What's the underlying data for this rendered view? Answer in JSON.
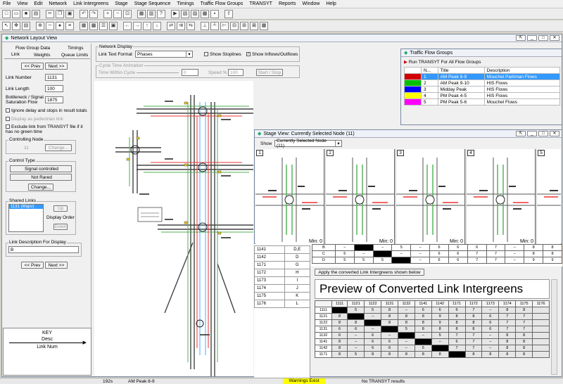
{
  "menu": [
    "File",
    "View",
    "Edit",
    "Network",
    "Link Intergreens",
    "Stage",
    "Stage Sequence",
    "Timings",
    "Traffic Flow Groups",
    "TRANSYT",
    "Reports",
    "Window",
    "Help"
  ],
  "network_window": {
    "title": "Network Layout View"
  },
  "link_panel": {
    "tabs_row1": [
      "Flow Group Data",
      "Timings"
    ],
    "tabs_row2": [
      "Link",
      "Weights",
      "Queue Limits"
    ],
    "prev_label": "<< Prev",
    "next_label": "Next >>",
    "link_number_label": "Link Number",
    "link_number": "1131",
    "link_length_label": "Link Length",
    "link_length": "100",
    "sat_flow_label": "Bottleneck / Signal Saturation Flow",
    "sat_flow": "1875",
    "ignore_delay": "Ignore delay and stops in result totals",
    "display_ped": "Display as pedestrian link",
    "exclude_link": "Exclude link from TRANSYT file if it has no green time",
    "controlling_node_label": "Controlling Node",
    "controlling_node": "11",
    "change_label": "Change...",
    "control_type_label": "Control Type",
    "control_type": "Signal controlled",
    "rared": "Not Rared",
    "shared_links_label": "Shared Links",
    "shared_link_item": "1131 (Major)",
    "up_label": "Up",
    "display_order": "Display Order",
    "down_label": "Down",
    "link_desc_label": "Link Description For Display",
    "link_desc": "B"
  },
  "key": {
    "title": "KEY",
    "desc": "Desc",
    "num": "Link Num"
  },
  "network_display": {
    "label": "Network Display",
    "format_label": "Link Text Format",
    "format_value": "Phases",
    "stoplines": "Show Stoplines",
    "inflows": "Show Inflows/Outflows",
    "anim_label": "Cycle Time Animation",
    "time_label": "Time Within Cycle",
    "time_value": "0",
    "speed_label": "Speed %",
    "speed_value": "100",
    "start_label": "Start / Stop"
  },
  "flow_groups": {
    "title": "Traffic Flow Groups",
    "run_label": "Run TRANSYT For All Flow Groups",
    "columns": [
      "N...",
      "Title",
      "Description"
    ],
    "rows": [
      {
        "n": "1",
        "title": "AM Peak 8-9",
        "desc": "Mouchel Parkman Flows",
        "color": "#d00000"
      },
      {
        "n": "2",
        "title": "AM Peak 9-10",
        "desc": "HIS Flows",
        "color": "#00c000"
      },
      {
        "n": "3",
        "title": "Midday Peak",
        "desc": "HIS Flows",
        "color": "#0000ff"
      },
      {
        "n": "4",
        "title": "PM Peak 4-5",
        "desc": "HIS Flows",
        "color": "#ffff00"
      },
      {
        "n": "5",
        "title": "PM Peak 5-6",
        "desc": "Mouchel Flows",
        "color": "#ff00ff"
      }
    ]
  },
  "stage_view": {
    "title": "Stage View: Currently Selected Node (11)",
    "show_label": "Show",
    "show_value": "Currently Selected Node (11)",
    "stages": [
      "1",
      "2",
      "3",
      "4",
      "5"
    ],
    "min_label": "Min: 0"
  },
  "link_list": [
    "1141",
    "1142",
    "1171",
    "1172",
    "1173",
    "1174",
    "1175",
    "1176"
  ],
  "link_list_codes": [
    "D,E",
    "D",
    "G",
    "H",
    "I",
    "J",
    "K",
    "L"
  ],
  "ig_top_rows": [
    [
      "B",
      "–",
      "",
      "–",
      "5",
      "–",
      "6",
      "6",
      "6",
      "7",
      "–",
      "8",
      "8"
    ],
    [
      "C",
      "5",
      "–",
      "",
      "–",
      "–",
      "6",
      "6",
      "7",
      "7",
      "–",
      "8",
      "8"
    ],
    [
      "D",
      "5",
      "5",
      "5",
      "",
      "–",
      "6",
      "6",
      "7",
      "7",
      "–",
      "9",
      "9"
    ]
  ],
  "preview": {
    "apply_label": "Apply the converted Link Intergreens shown below",
    "title": "Preview of Converted Link Intergreens",
    "cols": [
      "",
      "1111",
      "1121",
      "1122",
      "1131",
      "1132",
      "1141",
      "1142",
      "1171",
      "1172",
      "1173",
      "1174",
      "1175",
      "1176"
    ],
    "rows": [
      [
        "1111",
        "",
        "5",
        "5",
        "8",
        "–",
        "6",
        "6",
        "6",
        "7",
        "–",
        "8",
        "8",
        ""
      ],
      [
        "1121",
        "8",
        "",
        "–",
        "8",
        "8",
        "8",
        "9",
        "8",
        "8",
        "6",
        "7",
        "7",
        ""
      ],
      [
        "1122",
        "8",
        "8",
        "–",
        "8",
        "8",
        "8",
        "9",
        "8",
        "8",
        "6",
        "7",
        "7",
        ""
      ],
      [
        "1131",
        "6",
        "6",
        "–",
        "",
        "5",
        "8",
        "8",
        "8",
        "8",
        "6",
        "7",
        "7",
        ""
      ],
      [
        "1132",
        "6",
        "–",
        "6",
        "–",
        "",
        "–",
        "5",
        "7",
        "7",
        "–",
        "8",
        "8",
        ""
      ],
      [
        "1141",
        "8",
        "–",
        "6",
        "6",
        "–",
        "",
        "–",
        "6",
        "7",
        "–",
        "8",
        "8",
        ""
      ],
      [
        "1142",
        "8",
        "–",
        "6",
        "6",
        "–",
        "5",
        "",
        "7",
        "7",
        "–",
        "8",
        "8",
        ""
      ],
      [
        "1171",
        "8",
        "5",
        "8",
        "8",
        "8",
        "8",
        "8",
        "",
        "8",
        "8",
        "8",
        "8",
        ""
      ]
    ]
  },
  "status": {
    "cycle": "192s",
    "group": "AM Peak 8-9",
    "warnings": "Warnings Exist",
    "results": "No TRANSYT results"
  }
}
